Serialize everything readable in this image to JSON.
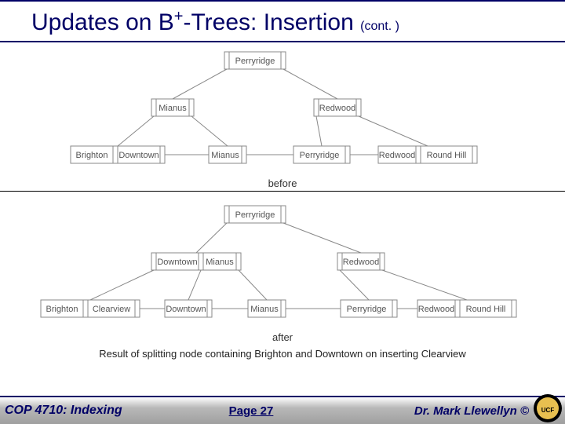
{
  "title": {
    "pre": "Updates on B",
    "sup": "+",
    "post": "-Trees:  Insertion",
    "cont": "(cont. )"
  },
  "before": {
    "caption": "before",
    "root": [
      "Perryridge"
    ],
    "mid": [
      [
        "Mianus"
      ],
      [
        "Redwood"
      ]
    ],
    "leaves": [
      [
        "Brighton",
        "Downtown"
      ],
      [
        "Mianus"
      ],
      [
        "Perryridge"
      ],
      [
        "Redwood",
        "Round Hill"
      ]
    ]
  },
  "after": {
    "caption": "after",
    "root": [
      "Perryridge"
    ],
    "mid": [
      [
        "Downtown",
        "Mianus"
      ],
      [
        "Redwood"
      ]
    ],
    "leaves": [
      [
        "Brighton",
        "Clearview"
      ],
      [
        "Downtown"
      ],
      [
        "Mianus"
      ],
      [
        "Perryridge"
      ],
      [
        "Redwood",
        "Round Hill"
      ]
    ]
  },
  "result_text": "Result of splitting node containing Brighton and Downtown on inserting Clearview",
  "footer": {
    "left": "COP 4710: Indexing",
    "mid": "Page 27",
    "right": "Dr. Mark Llewellyn ©"
  }
}
